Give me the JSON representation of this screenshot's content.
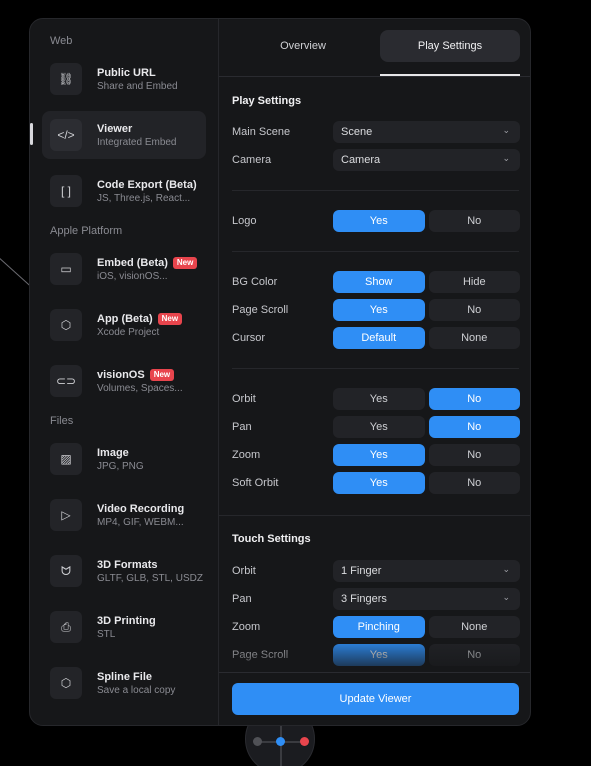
{
  "sidebar": {
    "sections": [
      {
        "label": "Web"
      },
      {
        "label": "Apple Platform"
      },
      {
        "label": "Files"
      }
    ],
    "items": [
      {
        "title": "Public URL",
        "sub": "Share and Embed",
        "icon": "link-icon",
        "glyph": "⛓"
      },
      {
        "title": "Viewer",
        "sub": "Integrated Embed",
        "icon": "code-icon",
        "glyph": "</>"
      },
      {
        "title": "Code Export (Beta)",
        "sub": "JS, Three.js, React...",
        "icon": "brackets-icon",
        "glyph": "[ ]"
      },
      {
        "title": "Embed (Beta)",
        "sub": "iOS, visionOS...",
        "icon": "devices-icon",
        "glyph": "▭",
        "badge": "New"
      },
      {
        "title": "App (Beta)",
        "sub": "Xcode Project",
        "icon": "cube-icon",
        "glyph": "⬡",
        "badge": "New"
      },
      {
        "title": "visionOS",
        "sub": "Volumes, Spaces...",
        "icon": "vision-headset-icon",
        "glyph": "⊂⊃",
        "badge": "New"
      },
      {
        "title": "Image",
        "sub": "JPG, PNG",
        "icon": "image-icon",
        "glyph": "▨"
      },
      {
        "title": "Video Recording",
        "sub": "MP4, GIF, WEBM...",
        "icon": "play-icon",
        "glyph": "▷"
      },
      {
        "title": "3D Formats",
        "sub": "GLTF, GLB, STL, USDZ",
        "icon": "bunny-icon",
        "glyph": "ᗢ"
      },
      {
        "title": "3D Printing",
        "sub": "STL",
        "icon": "printer-icon",
        "glyph": "⎙"
      },
      {
        "title": "Spline File",
        "sub": "Save a local copy",
        "icon": "cube-outline-icon",
        "glyph": "⬡"
      }
    ]
  },
  "tabs": [
    {
      "label": "Overview"
    },
    {
      "label": "Play Settings"
    }
  ],
  "play_settings": {
    "title": "Play Settings",
    "main_scene": {
      "label": "Main Scene",
      "value": "Scene"
    },
    "camera": {
      "label": "Camera",
      "value": "Camera"
    },
    "logo": {
      "label": "Logo",
      "options": [
        "Yes",
        "No"
      ],
      "selected": 0
    },
    "bg_color": {
      "label": "BG Color",
      "options": [
        "Show",
        "Hide"
      ],
      "selected": 0
    },
    "page_scroll": {
      "label": "Page Scroll",
      "options": [
        "Yes",
        "No"
      ],
      "selected": 0
    },
    "cursor": {
      "label": "Cursor",
      "options": [
        "Default",
        "None"
      ],
      "selected": 0
    },
    "orbit": {
      "label": "Orbit",
      "options": [
        "Yes",
        "No"
      ],
      "selected": 1
    },
    "pan": {
      "label": "Pan",
      "options": [
        "Yes",
        "No"
      ],
      "selected": 1
    },
    "zoom": {
      "label": "Zoom",
      "options": [
        "Yes",
        "No"
      ],
      "selected": 0
    },
    "soft_orbit": {
      "label": "Soft Orbit",
      "options": [
        "Yes",
        "No"
      ],
      "selected": 0
    }
  },
  "touch_settings": {
    "title": "Touch Settings",
    "orbit": {
      "label": "Orbit",
      "value": "1 Finger"
    },
    "pan": {
      "label": "Pan",
      "value": "3 Fingers"
    },
    "zoom": {
      "label": "Zoom",
      "options": [
        "Pinching",
        "None"
      ],
      "selected": 0
    },
    "page_scroll": {
      "label": "Page Scroll",
      "options": [
        "Yes",
        "No"
      ],
      "selected": 0
    }
  },
  "footer": {
    "update_label": "Update Viewer"
  },
  "colors": {
    "accent": "#2f8ef5",
    "badge": "#e8454d",
    "panel": "#161719"
  },
  "gizmo": {
    "dots": [
      "#505156",
      "#2f8ef5",
      "#e8454d"
    ]
  }
}
